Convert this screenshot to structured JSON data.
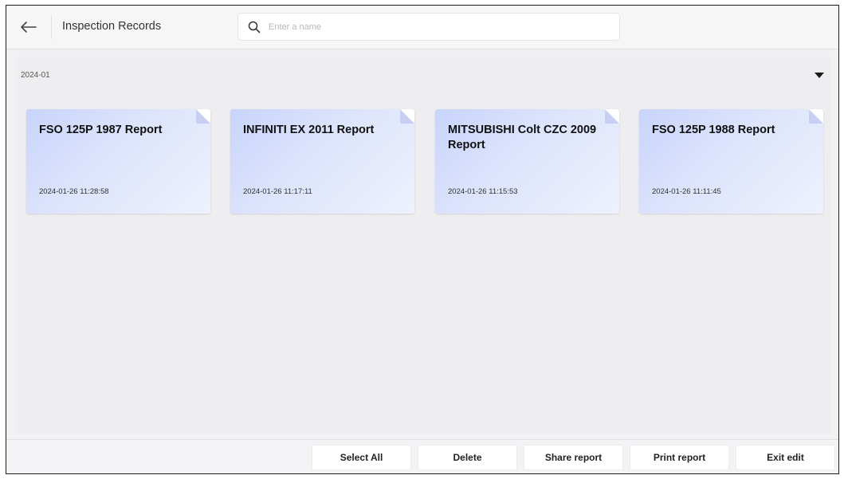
{
  "header": {
    "back_icon": "arrow-left-icon",
    "title": "Inspection Records",
    "search": {
      "placeholder": "Enter a name",
      "value": "",
      "icon": "search-icon"
    }
  },
  "group": {
    "label": "2024-01",
    "toggle_icon": "caret-down-icon"
  },
  "records": [
    {
      "title": "FSO 125P 1987 Report",
      "date": "2024-01-26 11:28:58"
    },
    {
      "title": "INFINITI EX 2011 Report",
      "date": "2024-01-26 11:17:11"
    },
    {
      "title": "MITSUBISHI Colt CZC 2009 Report",
      "date": "2024-01-26 11:15:53"
    },
    {
      "title": "FSO 125P 1988 Report",
      "date": "2024-01-26 11:11:45"
    }
  ],
  "actions": {
    "select_all": "Select All",
    "delete": "Delete",
    "share": "Share report",
    "print": "Print report",
    "exit": "Exit edit"
  },
  "colors": {
    "card_gradient_start": "#c9d4fb",
    "card_gradient_end": "#eef1fd",
    "background": "#f1f1f3"
  }
}
